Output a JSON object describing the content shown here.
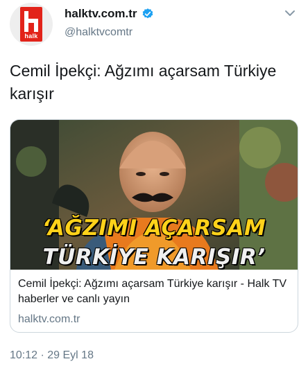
{
  "account": {
    "display_name": "halktv.com.tr",
    "handle": "@halktvcomtr",
    "logo_text": "halk",
    "verified": true,
    "brand_color": "#e2231a",
    "verified_color": "#1da1f2"
  },
  "tweet": {
    "text": "Cemil İpekçi: Ağzımı açarsam Türkiye karışır",
    "timestamp": "10:12 · 29 Eyl 18"
  },
  "card": {
    "image_headline_line1": "‘AĞZIMI AÇARSAM",
    "image_headline_line2": "TÜRKİYE KARIŞIR’",
    "title": "Cemil İpekçi: Ağzımı açarsam Türkiye karışır - Halk TV haberler ve canlı yayın",
    "domain": "halktv.com.tr",
    "image_alt": "Cemil İpekçi fotoğrafı"
  },
  "icons": {
    "verified": "verified-badge-icon",
    "more": "chevron-down-icon"
  }
}
